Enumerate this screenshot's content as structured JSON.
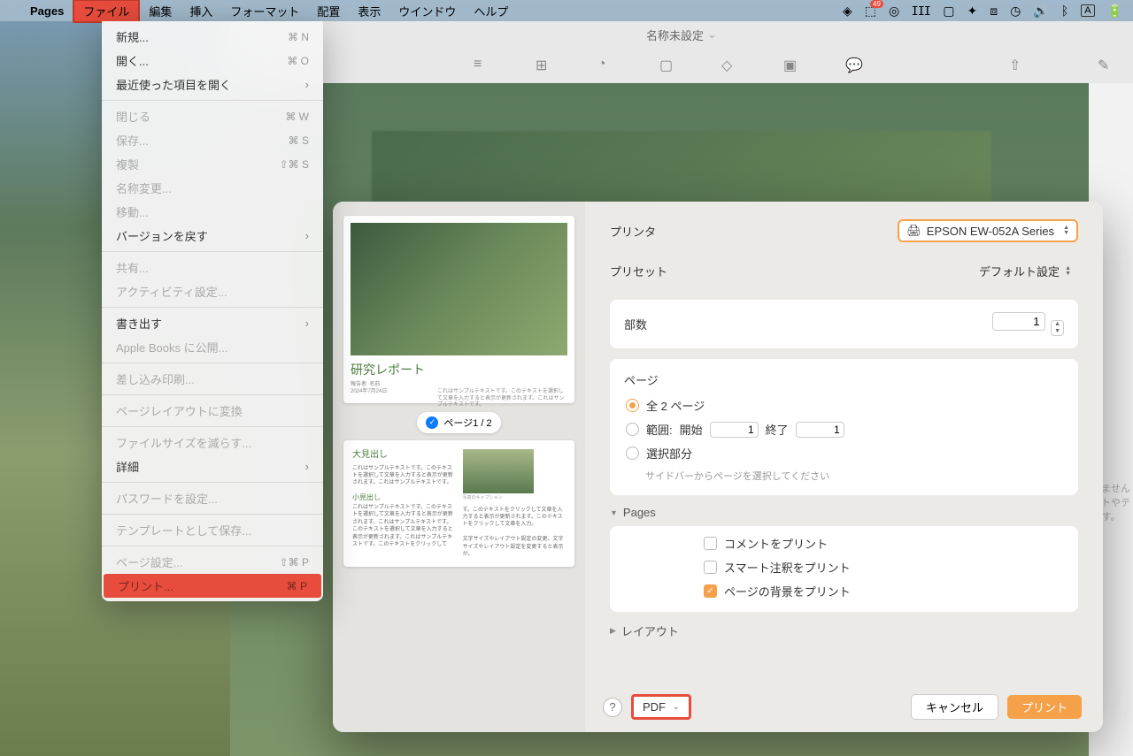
{
  "menubar": {
    "app": "Pages",
    "items": [
      "ファイル",
      "編集",
      "挿入",
      "フォーマット",
      "配置",
      "表示",
      "ウインドウ",
      "ヘルプ"
    ],
    "right_badge": "49",
    "input_indicator": "A"
  },
  "dropdown": {
    "groups": [
      [
        {
          "label": "新規...",
          "sc": "⌘ N"
        },
        {
          "label": "開く...",
          "sc": "⌘ O"
        },
        {
          "label": "最近使った項目を開く",
          "chev": true
        }
      ],
      [
        {
          "label": "閉じる",
          "sc": "⌘ W",
          "disabled": true
        },
        {
          "label": "保存...",
          "sc": "⌘ S",
          "disabled": true
        },
        {
          "label": "複製",
          "sc": "⇧⌘ S",
          "disabled": true
        },
        {
          "label": "名称変更...",
          "disabled": true
        },
        {
          "label": "移動...",
          "disabled": true
        },
        {
          "label": "バージョンを戻す",
          "chev": true
        }
      ],
      [
        {
          "label": "共有...",
          "disabled": true
        },
        {
          "label": "アクティビティ設定...",
          "disabled": true
        }
      ],
      [
        {
          "label": "書き出す",
          "chev": true
        },
        {
          "label": "Apple Books に公開...",
          "disabled": true
        }
      ],
      [
        {
          "label": "差し込み印刷...",
          "disabled": true
        }
      ],
      [
        {
          "label": "ページレイアウトに変換",
          "disabled": true
        }
      ],
      [
        {
          "label": "ファイルサイズを減らす...",
          "disabled": true
        },
        {
          "label": "詳細",
          "chev": true
        }
      ],
      [
        {
          "label": "パスワードを設定...",
          "disabled": true
        }
      ],
      [
        {
          "label": "テンプレートとして保存...",
          "disabled": true
        }
      ],
      [
        {
          "label": "ページ設定...",
          "sc": "⇧⌘ P",
          "disabled": true
        },
        {
          "label": "プリント...",
          "sc": "⌘ P",
          "disabled": true,
          "highlight": true
        }
      ]
    ]
  },
  "pages_window": {
    "title": "名称未設定",
    "side_hint": "いません\nクトやテ\nす。"
  },
  "preview": {
    "title": "研究レポート",
    "meta1": "報告者: 名前",
    "meta2": "2024年7月24日",
    "badge": "ページ1 / 2",
    "p2_h1": "大見出し",
    "p2_h2": "小見出し",
    "p2_cap": "写真のキャプション"
  },
  "print": {
    "printer_label": "プリンタ",
    "printer_value": "EPSON EW-052A Series",
    "preset_label": "プリセット",
    "preset_value": "デフォルト設定",
    "copies_label": "部数",
    "copies_value": "1",
    "pages_label": "ページ",
    "all_pages": "全 2 ページ",
    "range_label": "範囲:",
    "range_start_label": "開始",
    "range_start": "1",
    "range_end_label": "終了",
    "range_end": "1",
    "selection": "選択部分",
    "selection_hint": "サイドバーからページを選択してください",
    "app_section": "Pages",
    "opt_comments": "コメントをプリント",
    "opt_smart": "スマート注釈をプリント",
    "opt_bg": "ページの背景をプリント",
    "layout_section": "レイアウト",
    "help": "?",
    "pdf": "PDF",
    "cancel": "キャンセル",
    "submit": "プリント"
  }
}
